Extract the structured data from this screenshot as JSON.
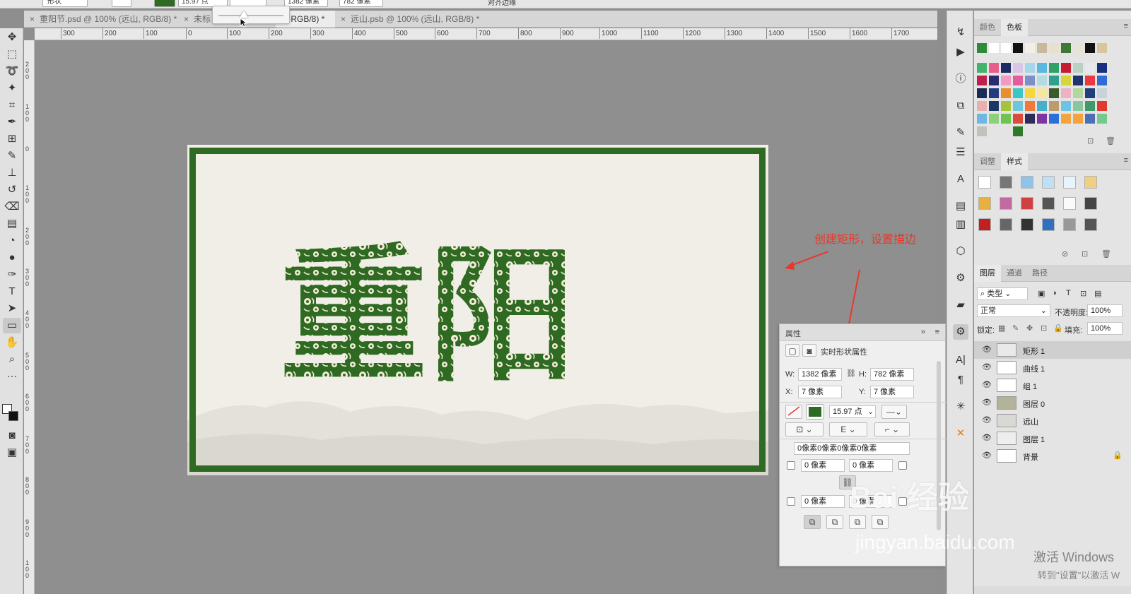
{
  "options_bar": {
    "mode_label": "形状",
    "stroke_size": "15.97 点",
    "w_value": "1382 像素",
    "h_value": "782 像素",
    "align_edges_label": "对齐边缘"
  },
  "tabs": [
    {
      "label": "重阳节.psd @ 100% (远山, RGB/8) *",
      "active": false
    },
    {
      "label": "未标",
      "active": false
    },
    {
      "label": "1, RGB/8) *",
      "active": true
    },
    {
      "label": "远山.psb @ 100% (远山, RGB/8) *",
      "active": false
    }
  ],
  "ruler_top": [
    "300",
    "200",
    "100",
    "0",
    "100",
    "200",
    "300",
    "400",
    "500",
    "600",
    "700",
    "800",
    "900",
    "1000",
    "1100",
    "1200",
    "1300",
    "1400",
    "1500",
    "1600",
    "1700"
  ],
  "ruler_left": [
    "2 0 0",
    "1 0 0",
    "0",
    "1 0 0",
    "2 0 0",
    "3 0 0",
    "4 0 0",
    "5 0 0",
    "6 0 0",
    "7 0 0",
    "8 0 0",
    "9 0 0",
    "1 0 0"
  ],
  "canvas": {
    "title_text": "重阳",
    "frame_color": "#2f6a22",
    "bg_color": "#f0eee7"
  },
  "annotation": {
    "text": "创建矩形，设置描边",
    "color": "#e8382b"
  },
  "properties": {
    "title": "属性",
    "subtitle": "实时形状属性",
    "w_label": "W:",
    "w_value": "1382 像素",
    "h_label": "H:",
    "h_value": "782 像素",
    "x_label": "X:",
    "x_value": "7 像素",
    "y_label": "Y:",
    "y_value": "7 像素",
    "stroke_width": "15.97 点",
    "corner_all": "0像素0像素0像素0像素",
    "corner_tl": "0 像素",
    "corner_tr": "0 像素",
    "corner_bl": "0 像素",
    "corner_br": "0 像素"
  },
  "color_panel": {
    "tabs": [
      "颜色",
      "色板"
    ],
    "swatches_row0": [
      "#2e8a3a",
      "#ffffff",
      "#ffffff",
      "#111111",
      "#f2efe6",
      "#c8b99a",
      "#e6e0cc",
      "#3e7a36",
      "#e7e3d6",
      "#111111",
      "#d8c59c"
    ],
    "swatches": [
      "#41b36a",
      "#e85d8c",
      "#1d2a66",
      "#d9c6e6",
      "#a6d6ee",
      "#58b8dd",
      "#31a16a",
      "#c51e32",
      "#b7d2c3",
      "#e8e8e8",
      "#1b2f80",
      "#c01f4d",
      "#2b2a70",
      "#f19ac2",
      "#e35d9d",
      "#7c8fc7",
      "#b1dce1",
      "#2f9f8e",
      "#d6d53a",
      "#1e356e",
      "#ea3a3f",
      "#2e6cd6",
      "#1c2a58",
      "#253a7d",
      "#e88f30",
      "#3bc5c4",
      "#f5d63b",
      "#f3e89b",
      "#3a5a2b",
      "#ecb3c6",
      "#b3d69c",
      "#213f7a",
      "#c8d2d9",
      "#e9b0b0",
      "#1b3765",
      "#a7c33d",
      "#71c5d8",
      "#f07a3b",
      "#45b0c6",
      "#bd9c6b",
      "#6dc2e6",
      "#8ac7a1",
      "#3f9a6a",
      "#e03a2e",
      "#6cb7e3",
      "#8cd17a",
      "#6ec44e",
      "#db4a3b",
      "#2e2a59",
      "#7c35a3",
      "#2d6fd9",
      "#f2a53e",
      "#f5a33e",
      "#4c6fb5",
      "#76c98d"
    ],
    "swatches_tail": [
      "#bfc2bd",
      "#2f7a2a"
    ]
  },
  "styles_panel": {
    "tabs": [
      "调整",
      "样式"
    ]
  },
  "layers_panel": {
    "tabs": [
      "图层",
      "通道",
      "路径"
    ],
    "filter_label": "类型",
    "blend_mode": "正常",
    "opacity_label": "不透明度:",
    "opacity_value": "100%",
    "lock_label": "锁定:",
    "fill_label": "填充:",
    "fill_value": "100%",
    "layers": [
      {
        "name": "矩形 1",
        "selected": true,
        "locked": false
      },
      {
        "name": "曲线 1",
        "selected": false,
        "locked": false
      },
      {
        "name": "组 1",
        "selected": false,
        "locked": false
      },
      {
        "name": "图层 0",
        "selected": false,
        "locked": false
      },
      {
        "name": "远山",
        "selected": false,
        "locked": false
      },
      {
        "name": "图层 1",
        "selected": false,
        "locked": false
      },
      {
        "name": "背景",
        "selected": false,
        "locked": true
      }
    ]
  },
  "watermark": {
    "text": "Bai 经验",
    "url": "jingyan.baidu.com",
    "windows_line1": "激活 Windows",
    "windows_line2": "转到\"设置\"以激活 W"
  }
}
